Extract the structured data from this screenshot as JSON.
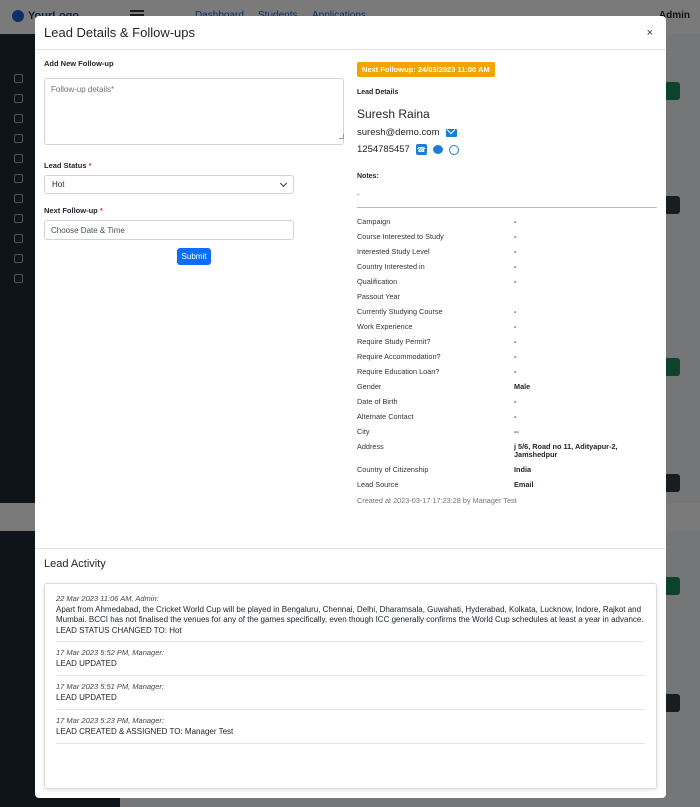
{
  "background": {
    "logo": "YourLogo",
    "nav": [
      "Dashboard",
      "Students",
      "Applications"
    ],
    "admin": "Admin"
  },
  "modal": {
    "title": "Lead Details & Follow-ups",
    "close": "×"
  },
  "followup_form": {
    "section_label": "Add New Follow-up",
    "details_placeholder": "Follow-up details*",
    "lead_status_label": "Lead Status",
    "required_mark": "*",
    "lead_status_value": "Hot",
    "next_followup_label": "Next Follow-up",
    "date_placeholder": "Choose Date & Time",
    "submit_label": "Submit"
  },
  "lead": {
    "next_followup_badge": "Next Followup: 24/03/2023 11:00 AM",
    "details_label": "Lead Details",
    "name": "Suresh Raina",
    "email": "suresh@demo.com",
    "phone": "1254785457",
    "notes_label": "Notes:",
    "notes_value": "-",
    "fields": [
      {
        "key": "Campaign",
        "value": "-"
      },
      {
        "key": "Course Interested to Study",
        "value": "-"
      },
      {
        "key": "Interested Study Level",
        "value": "-"
      },
      {
        "key": "Country Interested in",
        "value": "-"
      },
      {
        "key": "Qualification",
        "value": "-"
      },
      {
        "key": "Passout Year",
        "value": ""
      },
      {
        "key": "Currently Studying Course",
        "value": "-"
      },
      {
        "key": "Work Experience",
        "value": "-"
      },
      {
        "key": "Require Study Permit?",
        "value": "-"
      },
      {
        "key": "Require Accommodation?",
        "value": "-"
      },
      {
        "key": "Require Education Loan?",
        "value": "-"
      },
      {
        "key": "Gender",
        "value": "Male"
      },
      {
        "key": "Date of Birth",
        "value": "-"
      },
      {
        "key": "Alternate Contact",
        "value": "-"
      },
      {
        "key": "City",
        "value": "--"
      },
      {
        "key": "Address",
        "value": "j 5/6, Road no 11, Adityapur-2, Jamshedpur"
      },
      {
        "key": "Country of Citizenship",
        "value": "India"
      },
      {
        "key": "Lead Source",
        "value": "Email"
      }
    ],
    "created_at": "Created at 2023-03-17 17:23:28 by Manager Test"
  },
  "activity": {
    "title": "Lead Activity",
    "items": [
      {
        "meta": "22 Mar 2023 11:06 AM, Admin:",
        "text": "Apart from Ahmedabad, the Cricket World Cup will be played in Bengaluru, Chennai, Delhi, Dharamsala, Guwahati, Hyderabad, Kolkata, Lucknow, Indore, Rajkot and Mumbai. BCCI has not finalised the venues for any of the games specifically, even though ICC generally confirms the World Cup schedules at least a year in advance.",
        "status": "LEAD STATUS CHANGED TO: Hot"
      },
      {
        "meta": "17 Mar 2023 5:52 PM, Manager:",
        "text": "LEAD UPDATED",
        "status": ""
      },
      {
        "meta": "17 Mar 2023 5:51 PM, Manager:",
        "text": "LEAD UPDATED",
        "status": ""
      },
      {
        "meta": "17 Mar 2023 5:23 PM, Manager:",
        "text": "LEAD CREATED & ASSIGNED TO: Manager Test",
        "status": ""
      }
    ]
  },
  "colors": {
    "primary": "#0d6efd",
    "badge": "#f0a500",
    "required": "#dc3545",
    "icon_blue": "#1c7ed6"
  }
}
